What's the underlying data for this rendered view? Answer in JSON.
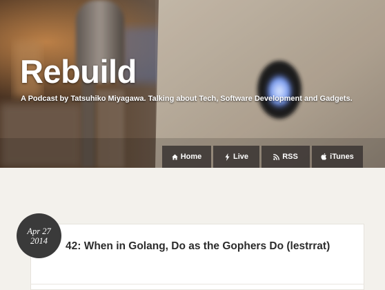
{
  "site": {
    "title": "Rebuild",
    "tagline": "A Podcast by Tatsuhiko Miyagawa. Talking about Tech, Software Development and Gadgets."
  },
  "nav": {
    "items": [
      {
        "label": "Home",
        "icon": "home-icon"
      },
      {
        "label": "Live",
        "icon": "lightning-icon"
      },
      {
        "label": "RSS",
        "icon": "rss-icon"
      },
      {
        "label": "iTunes",
        "icon": "apple-icon"
      }
    ]
  },
  "episode": {
    "date_line1": "Apr 27",
    "date_line2": "2014",
    "title": "42: When in Golang, Do as the Gophers Do (lestrrat)"
  },
  "colors": {
    "nav_bg": "#3c3734",
    "badge_bg": "#3a3a3a",
    "page_bg": "#f3f1ec",
    "title_text": "#2b2b2b"
  }
}
